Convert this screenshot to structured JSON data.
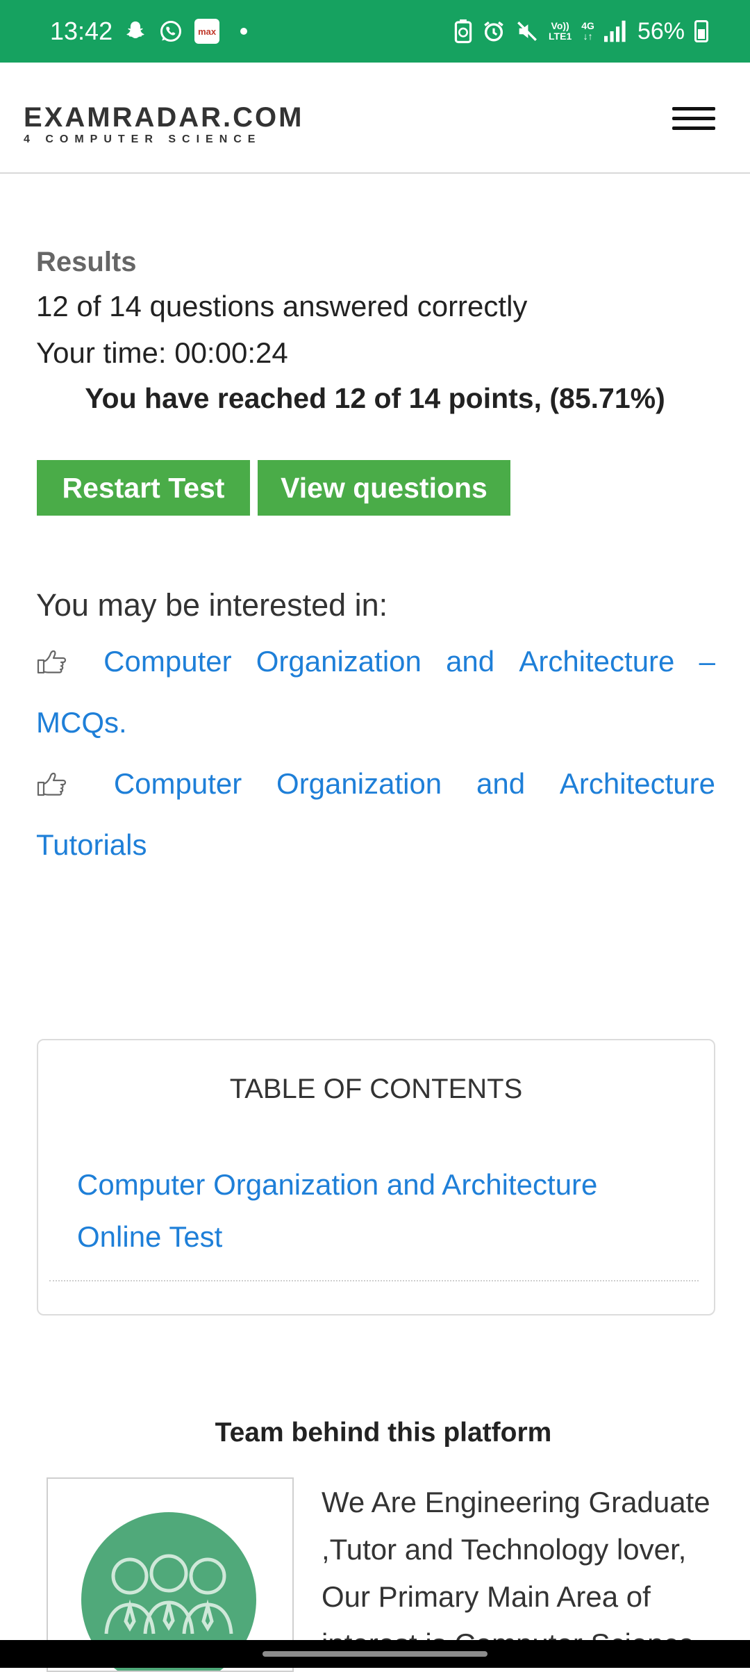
{
  "status_bar": {
    "time": "13:42",
    "app_badge": "max",
    "network_top": "Vo))",
    "network_bottom": "LTE1",
    "network_type": "4G",
    "battery": "56%",
    "icons": [
      "snapchat-icon",
      "whatsapp-icon",
      "max-app-icon",
      "battery-saver-icon",
      "alarm-icon",
      "mute-icon",
      "signal-icon",
      "battery-icon"
    ],
    "background": "#16a260"
  },
  "header": {
    "logo_main": "EXAMRADAR.COM",
    "logo_sub": "4 COMPUTER SCIENCE",
    "menu_icon": "hamburger-menu-icon"
  },
  "results": {
    "title": "Results",
    "answered": "12 of 14 questions answered correctly",
    "time": "Your time: 00:00:24",
    "points": "You have reached 12 of 14 points, (85.71%)"
  },
  "buttons": {
    "restart": "Restart Test",
    "view": "View questions",
    "color": "#4aac48"
  },
  "related": {
    "heading": "You may be interested in:",
    "links": [
      {
        "words": [
          "Computer",
          "Organization",
          "and",
          "Architecture",
          "–"
        ],
        "last": "MCQs."
      },
      {
        "words": [
          "Computer",
          "Organization",
          "and",
          "Architecture"
        ],
        "last": "Tutorials"
      }
    ],
    "icon": "hand-point-right-icon",
    "link_color": "#1e7fd8"
  },
  "toc": {
    "title": "TABLE OF CONTENTS",
    "items": [
      "Computer Organization and Architecture Online Test"
    ]
  },
  "team": {
    "title": "Team behind this platform",
    "description": "We Are Engineering Graduate ,Tutor and Technology lover, Our Primary Main Area of interest is Computer Science"
  }
}
